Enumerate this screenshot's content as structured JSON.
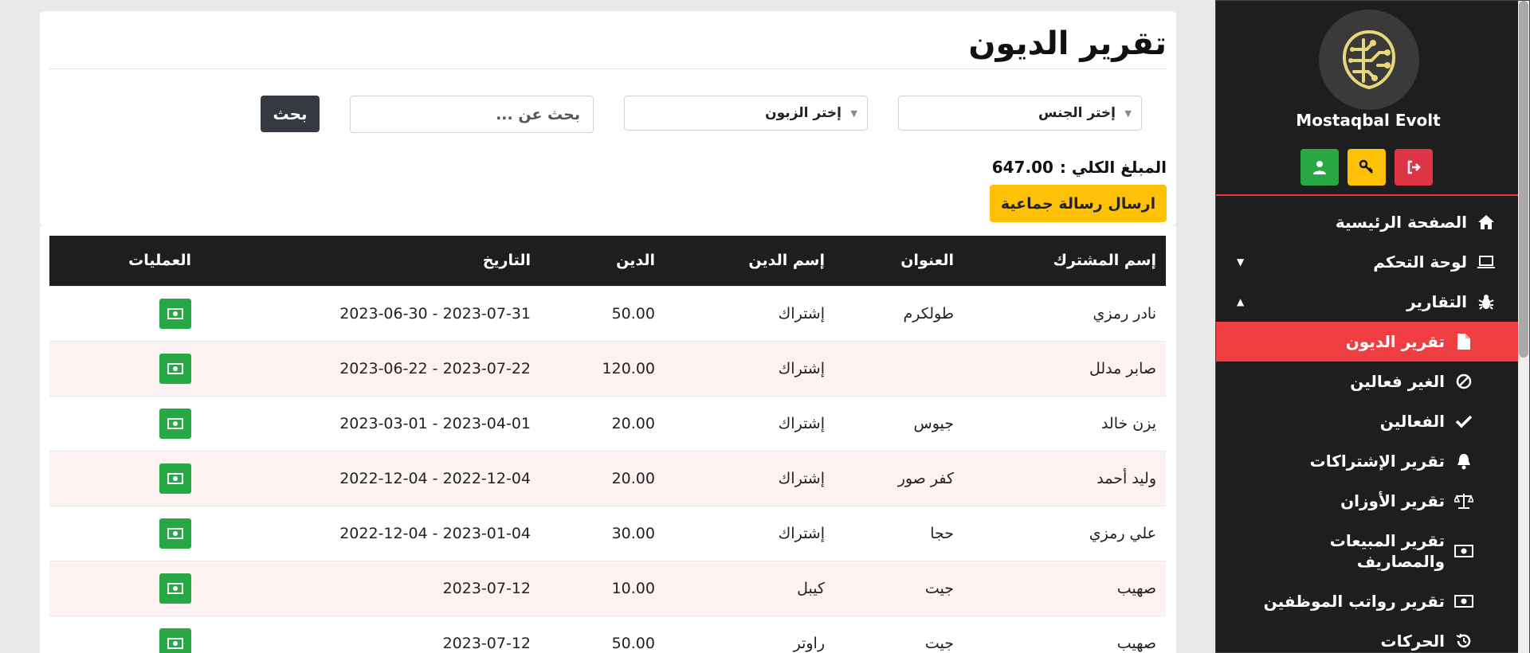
{
  "sidebar": {
    "brand": "Mostaqbal Evolt",
    "menu": [
      {
        "label": "الصفحة الرئيسية",
        "icon": "home-icon"
      },
      {
        "label": "لوحة التحكم",
        "icon": "laptop-icon",
        "arrow": "▼"
      },
      {
        "label": "التقارير",
        "icon": "bug-icon",
        "arrow": "▲"
      },
      {
        "label": "تقرير الديون",
        "icon": "file-icon"
      },
      {
        "label": "الغير فعالين",
        "icon": "ban-icon"
      },
      {
        "label": "الفعالين",
        "icon": "check-icon"
      },
      {
        "label": "تقرير الإشتراكات",
        "icon": "bell-icon"
      },
      {
        "label": "تقرير الأوزان",
        "icon": "scale-icon"
      },
      {
        "label": "تقرير المبيعات والمصاريف",
        "icon": "money-icon"
      },
      {
        "label": "تقرير رواتب الموظفين",
        "icon": "money-icon"
      },
      {
        "label": "الحركات",
        "icon": "history-icon"
      }
    ]
  },
  "page": {
    "title": "تقرير الديون",
    "filters": {
      "gender": "إختر الجنس",
      "customer": "إختر الزبون",
      "search_placeholder": "بحث عن ...",
      "search_button": "بحث"
    },
    "total_label": "المبلغ الكلي :",
    "total_value": "647.00",
    "bulk_message_button": "ارسال رسالة جماعية"
  },
  "table": {
    "headers": {
      "name": "إسم المشترك",
      "address": "العنوان",
      "debt_name": "إسم الدين",
      "amount": "الدين",
      "date": "التاريخ",
      "ops": "العمليات"
    },
    "rows": [
      {
        "name": "نادر رمزي",
        "address": "طولكرم",
        "debt_name": "إشتراك",
        "amount": "50.00",
        "date": "2023-06-30 - 2023-07-31"
      },
      {
        "name": "صابر مدلل",
        "address": "",
        "debt_name": "إشتراك",
        "amount": "120.00",
        "date": "2023-06-22 - 2023-07-22"
      },
      {
        "name": "يزن خالد",
        "address": "جيوس",
        "debt_name": "إشتراك",
        "amount": "20.00",
        "date": "2023-03-01 - 2023-04-01"
      },
      {
        "name": "وليد أحمد",
        "address": "كفر صور",
        "debt_name": "إشتراك",
        "amount": "20.00",
        "date": "2022-12-04 - 2022-12-04"
      },
      {
        "name": "علي رمزي",
        "address": "حجا",
        "debt_name": "إشتراك",
        "amount": "30.00",
        "date": "2022-12-04 - 2023-01-04"
      },
      {
        "name": "صهيب",
        "address": "جيت",
        "debt_name": "كيبل",
        "amount": "10.00",
        "date": "2023-07-12"
      },
      {
        "name": "صهيب",
        "address": "جيت",
        "debt_name": "راوتر",
        "amount": "50.00",
        "date": "2023-07-12"
      }
    ]
  },
  "colors": {
    "sidebar_bg": "#1e1e1e",
    "active_item": "#ef3e42",
    "accent_yellow": "#ffc107",
    "success": "#28a745",
    "danger": "#dc3545",
    "dark_button": "#343a40"
  }
}
